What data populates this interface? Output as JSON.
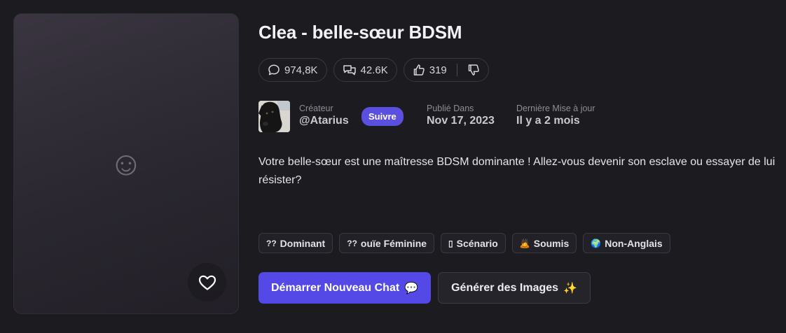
{
  "character": {
    "title": "Clea - belle-sœur BDSM",
    "description": "Votre belle-sœur est une maîtresse BDSM dominante ! Allez-vous devenir son esclave ou essayer de lui résister?"
  },
  "stats": {
    "messages": "974,8K",
    "chats": "42.6K",
    "likes": "319"
  },
  "creator": {
    "label": "Créateur",
    "handle": "@Atarius",
    "follow_label": "Suivre"
  },
  "published": {
    "label": "Publié Dans",
    "value": "Nov 17, 2023"
  },
  "updated": {
    "label": "Dernière Mise à jour",
    "value": "Il y a 2 mois"
  },
  "tags": [
    {
      "icon": "??",
      "label": "Dominant"
    },
    {
      "icon": "??",
      "label": "ouïe Féminine"
    },
    {
      "icon": "▯",
      "label": "Scénario"
    },
    {
      "icon": "🙇",
      "label": "Soumis"
    },
    {
      "icon": "🌍",
      "label": "Non-Anglais"
    }
  ],
  "actions": {
    "start_chat": "Démarrer Nouveau Chat",
    "start_chat_emoji": "💬",
    "generate_images": "Générer des Images",
    "generate_images_emoji": "✨"
  },
  "colors": {
    "accent": "#5448e6",
    "background": "#1c1b20"
  }
}
